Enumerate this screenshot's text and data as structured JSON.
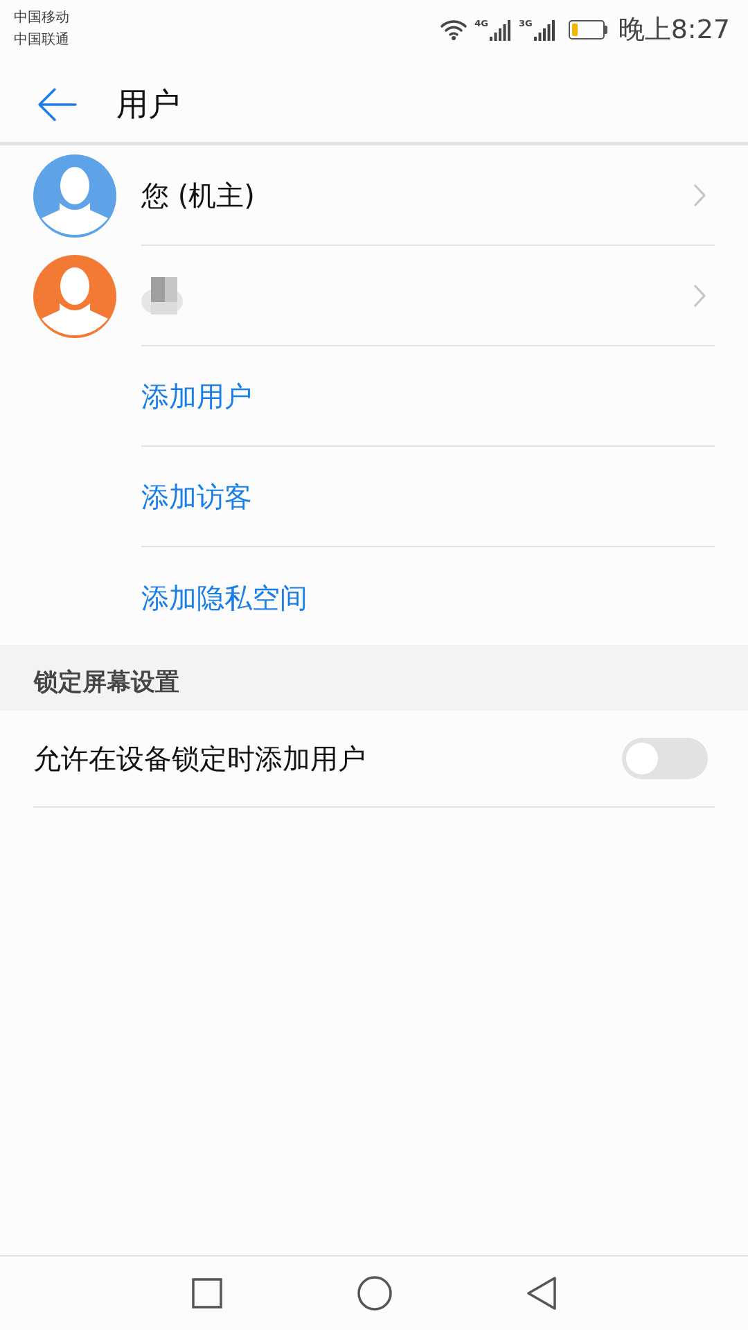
{
  "status_bar": {
    "carriers": [
      "中国移动",
      "中国联通"
    ],
    "network_1": "4G",
    "network_2": "3G",
    "time": "晚上8:27"
  },
  "header": {
    "title": "用户"
  },
  "users": [
    {
      "name": "您 (机主)",
      "color": "#5ea3e8",
      "name_hidden": false
    },
    {
      "color": "#f27a34",
      "name_hidden": true
    }
  ],
  "actions": [
    {
      "label": "添加用户"
    },
    {
      "label": "添加访客"
    },
    {
      "label": "添加隐私空间"
    }
  ],
  "section": {
    "title": "锁定屏幕设置"
  },
  "settings": [
    {
      "label": "允许在设备锁定时添加用户",
      "on": false
    }
  ]
}
